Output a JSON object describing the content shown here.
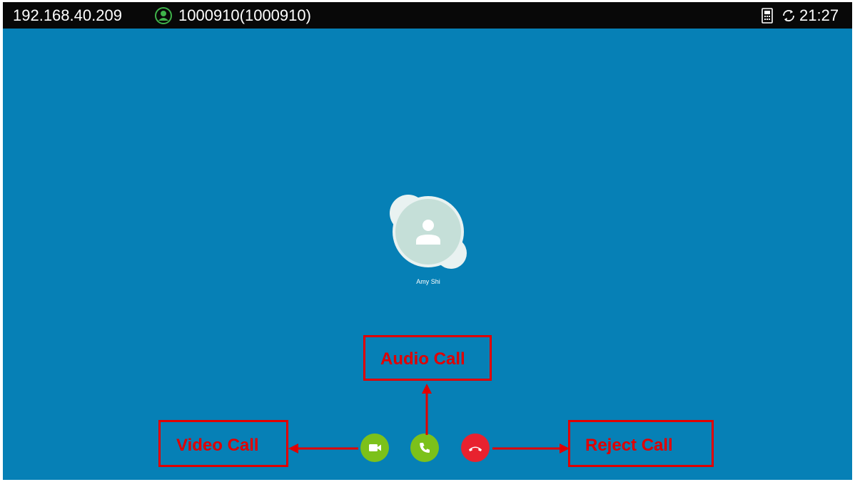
{
  "status_bar": {
    "ip_address": "192.168.40.209",
    "account": "1000910(1000910)",
    "time": "21:27",
    "account_icon": "user-circle-icon",
    "phone_icon": "phone-device-icon",
    "sync_icon": "sync-icon"
  },
  "caller": {
    "name": "Amy Shi",
    "avatar_icon": "person-icon"
  },
  "actions": {
    "video": {
      "icon": "video-camera-icon",
      "color": "#7CC11A"
    },
    "audio": {
      "icon": "phone-handset-icon",
      "color": "#7CC11A"
    },
    "reject": {
      "icon": "hang-up-icon",
      "color": "#E8222F"
    }
  },
  "annotations": {
    "audio_call": "Audio Call",
    "video_call": "Video Call",
    "reject_call": "Reject Call",
    "color": "#E10000"
  },
  "colors": {
    "background": "#0680B6",
    "status_bar": "#080808"
  }
}
